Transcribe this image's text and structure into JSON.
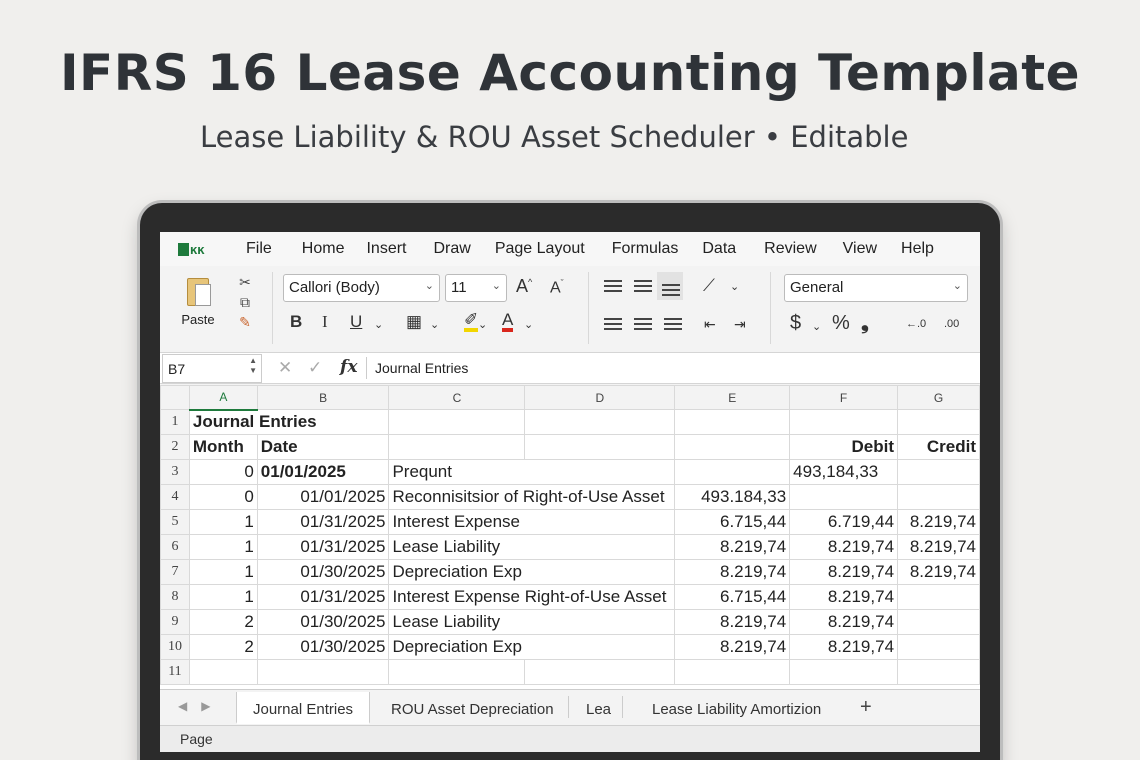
{
  "hero": {
    "title": "IFRS 16 Lease Accounting Template",
    "subtitle": "Lease Liability & ROU Asset Scheduler • Editable"
  },
  "menu": [
    "File",
    "Home",
    "Insert",
    "Draw",
    "Page Layout",
    "Formulas",
    "Data",
    "Review",
    "View",
    "Help"
  ],
  "ribbon": {
    "paste_label": "Paste",
    "font_name": "Callori (Body)",
    "font_size": "11",
    "number_format": "General",
    "bold": "B",
    "italic": "I",
    "underline": "U",
    "grow_font": "A",
    "shrink_font": "A",
    "currency": "$",
    "percent": "%",
    "comma": "❟",
    "inc_decimal": "←.0",
    "dec_decimal": ".00"
  },
  "formula_bar": {
    "cell_ref": "B7",
    "fx": "fx",
    "content": "Journal Entries"
  },
  "columns": [
    "A",
    "B",
    "C",
    "D",
    "E",
    "F",
    "G"
  ],
  "selected_column": "A",
  "sheet": {
    "title": "Journal Entries",
    "headers": {
      "month": "Month",
      "date": "Date",
      "debit": "Debit",
      "credit": "Credit"
    },
    "rows": [
      {
        "row": "3",
        "month": "0",
        "date": "01/01/2025",
        "desc": "Prequnt",
        "e": "",
        "f": "493,184,33",
        "g": "",
        "bold": true
      },
      {
        "row": "4",
        "month": "0",
        "date": "01/01/2025",
        "desc": "Reconnisitsior of Right-of-Use Asset",
        "e": "493.184,33",
        "f": "",
        "g": ""
      },
      {
        "row": "5",
        "month": "1",
        "date": "01/31/2025",
        "desc": "Interest Expense",
        "e": "6.715,44",
        "f": "6.719,44",
        "g": "8.219,74"
      },
      {
        "row": "6",
        "month": "1",
        "date": "01/31/2025",
        "desc": "Lease Liability",
        "e": "8.219,74",
        "f": "8.219,74",
        "g": "8.219,74"
      },
      {
        "row": "7",
        "month": "1",
        "date": "01/30/2025",
        "desc": "Depreciation Exp",
        "e": "8.219,74",
        "f": "8.219,74",
        "g": "8.219,74"
      },
      {
        "row": "8",
        "month": "1",
        "date": "01/31/2025",
        "desc": "Interest Expense Right-of-Use Asset",
        "e": "6.715,44",
        "f": "8.219,74",
        "g": ""
      },
      {
        "row": "9",
        "month": "2",
        "date": "01/30/2025",
        "desc": "Lease Liability",
        "e": "8.219,74",
        "f": "8.219,74",
        "g": ""
      },
      {
        "row": "10",
        "month": "2",
        "date": "01/30/2025",
        "desc": "Depreciation Exp",
        "e": "8.219,74",
        "f": "8.219,74",
        "g": ""
      }
    ]
  },
  "row_numbers": {
    "r1": "1",
    "r2": "2",
    "r11": "11"
  },
  "tabs": [
    "Journal Entries",
    "ROU Asset Depreciation",
    "Lea",
    "Lease Liability Amortizion"
  ],
  "active_tab": "Journal Entries",
  "add_tab": "+",
  "status": "Page",
  "colors": {
    "accent": "#1e7a3c",
    "highlight_yellow": "#f2d600",
    "font_red": "#d9261c"
  }
}
